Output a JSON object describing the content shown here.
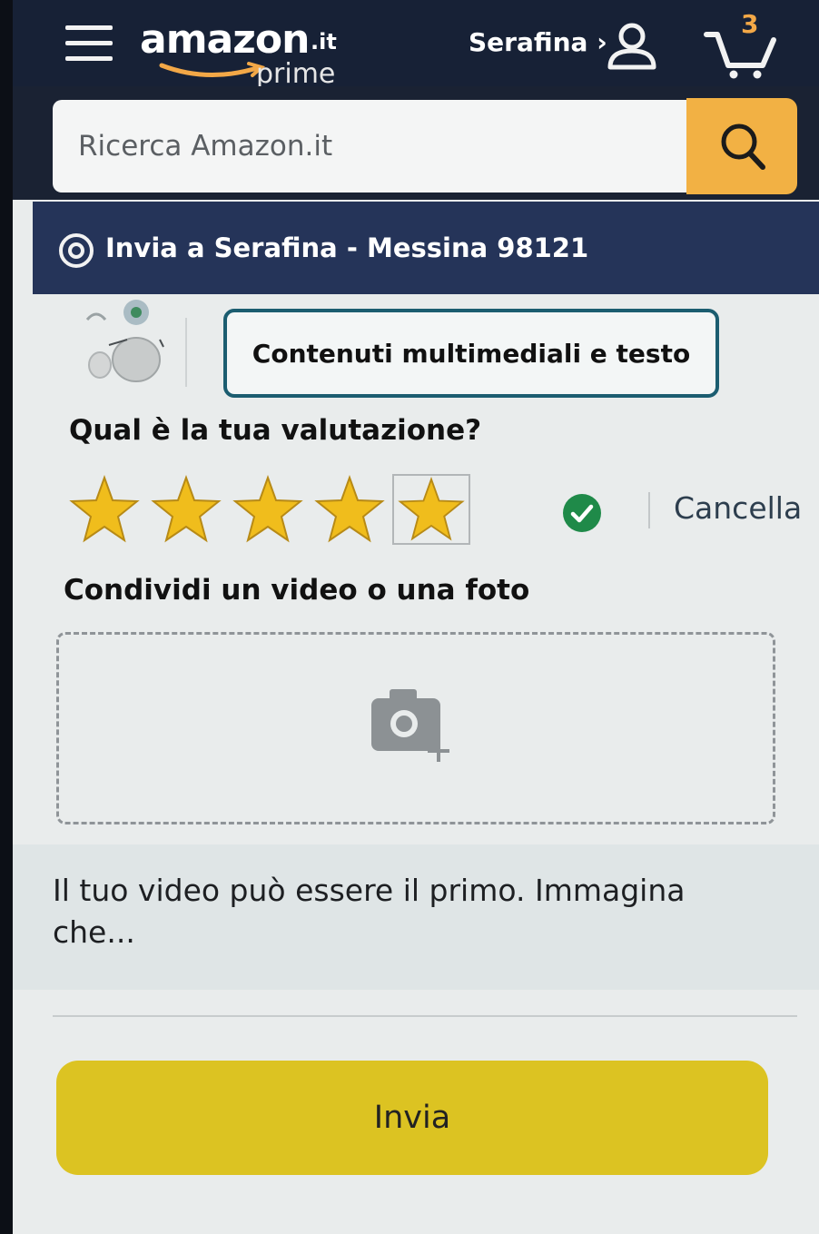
{
  "header": {
    "logo": {
      "word": "amazon",
      "tld": ".it",
      "tier": "prime"
    },
    "account_label": "Serafina ›",
    "cart_count": "3",
    "icons": [
      "menu-icon",
      "user-icon",
      "cart-icon"
    ]
  },
  "search": {
    "placeholder": "Ricerca Amazon.it",
    "button_icon": "search-icon"
  },
  "delivery": {
    "icon": "location-pin-icon",
    "text": "Invia a Serafina - Messina 98121"
  },
  "review": {
    "tab_label": "Contenuti multimediali e testo",
    "rating_heading": "Qual è la tua valutazione?",
    "rating": 5,
    "max_rating": 5,
    "clear_label": "Cancella",
    "share_heading": "Condividi un video o una foto",
    "upload_icon": "camera-add-icon",
    "prompt": "Il tuo video può essere il primo. Immagina che...",
    "submit_label": "Invia"
  },
  "colors": {
    "header_bg": "#172136",
    "search_button": "#f2b144",
    "delivery_bg": "#253459",
    "tab_border": "#1b5d70",
    "star_fill": "#f0bd1c",
    "check": "#1f8a49",
    "submit_bg": "#dcc322"
  }
}
